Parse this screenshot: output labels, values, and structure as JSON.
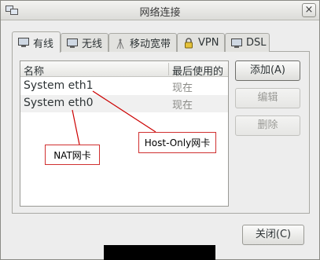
{
  "window": {
    "title": "网络连接",
    "close_label": "×"
  },
  "tabs": [
    {
      "label": "有线",
      "icon": "wired-icon",
      "active": true
    },
    {
      "label": "无线",
      "icon": "wireless-icon",
      "active": false
    },
    {
      "label": "移动宽带",
      "icon": "mobile-broadband-icon",
      "active": false
    },
    {
      "label": "VPN",
      "icon": "lock-icon",
      "active": false
    },
    {
      "label": "DSL",
      "icon": "dsl-icon",
      "active": false
    }
  ],
  "list": {
    "columns": [
      "名称",
      "最后使用的"
    ],
    "rows": [
      {
        "name": "System eth1",
        "last_used": "现在"
      },
      {
        "name": "System eth0",
        "last_used": "现在"
      }
    ]
  },
  "buttons": {
    "add": "添加(A)",
    "edit": "编辑",
    "delete": "删除",
    "close": "关闭(C)"
  },
  "annotations": {
    "host_only": "Host-Only网卡",
    "nat": "NAT网卡"
  },
  "colors": {
    "annotation_line": "#cc0000",
    "window_bg": "#ededed"
  }
}
